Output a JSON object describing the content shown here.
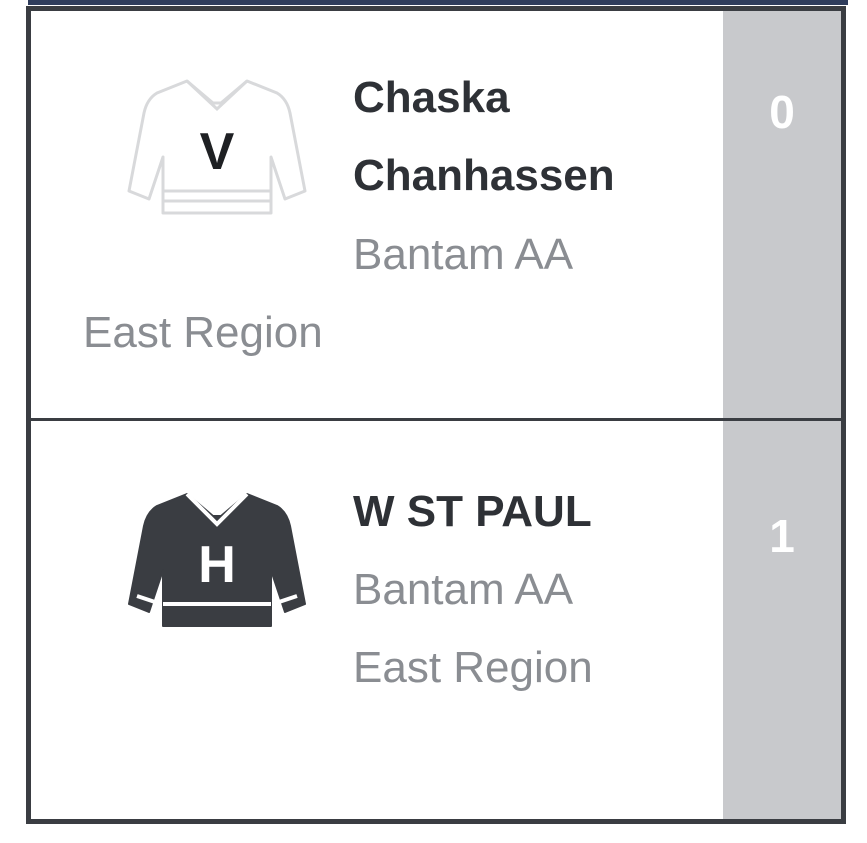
{
  "matchup": {
    "teams": [
      {
        "name": "Chaska Chanhassen",
        "level": "Bantam AA",
        "region": "East Region",
        "score": "0",
        "jersey_letter": "V",
        "jersey_style": "outline",
        "jersey_icon": "jersey-icon"
      },
      {
        "name": "W ST PAUL",
        "level": "Bantam AA",
        "region": "East Region",
        "score": "1",
        "jersey_letter": "H",
        "jersey_style": "filled",
        "jersey_icon": "jersey-icon"
      }
    ]
  },
  "colors": {
    "border": "#3a3d42",
    "score_column": "#c8c9cc",
    "team_name": "#2e3136",
    "meta_text": "#8a8d92",
    "jersey_dark": "#3a3d42",
    "jersey_light": "#d8d9db"
  }
}
